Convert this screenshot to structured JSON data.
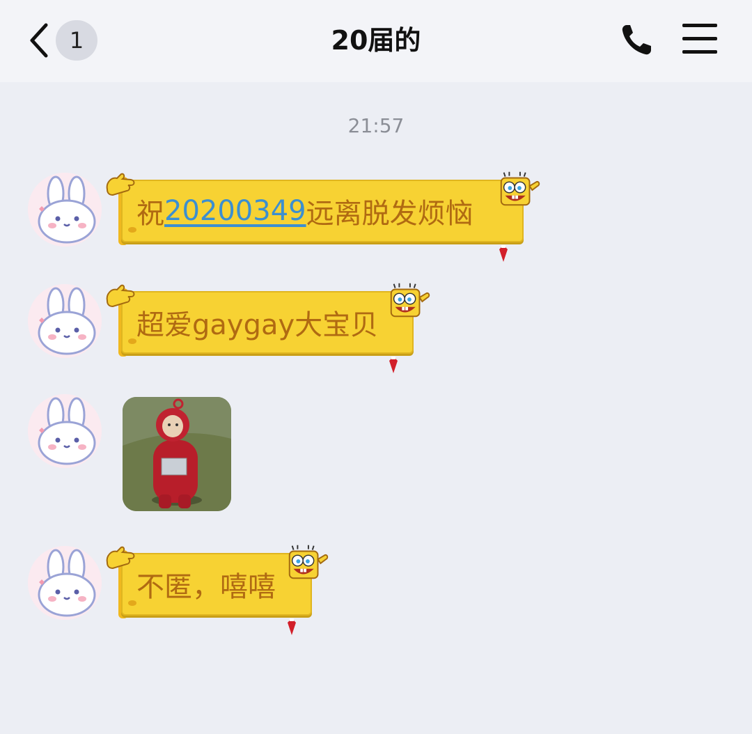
{
  "header": {
    "unread_count": "1",
    "title": "20届的"
  },
  "chat": {
    "timestamp": "21:57",
    "messages": [
      {
        "type": "text",
        "prefix": "祝",
        "link": "20200349",
        "suffix": "远离脱发烦恼"
      },
      {
        "type": "text",
        "text": "超爱gaygay大宝贝"
      },
      {
        "type": "image",
        "description": "sticker-red-teletubby"
      },
      {
        "type": "text",
        "text": "不匿，嘻嘻"
      }
    ]
  },
  "colors": {
    "background": "#eceef4",
    "bubble": "#f7d233",
    "bubble_text": "#b06a12",
    "link": "#3c8fd0"
  }
}
